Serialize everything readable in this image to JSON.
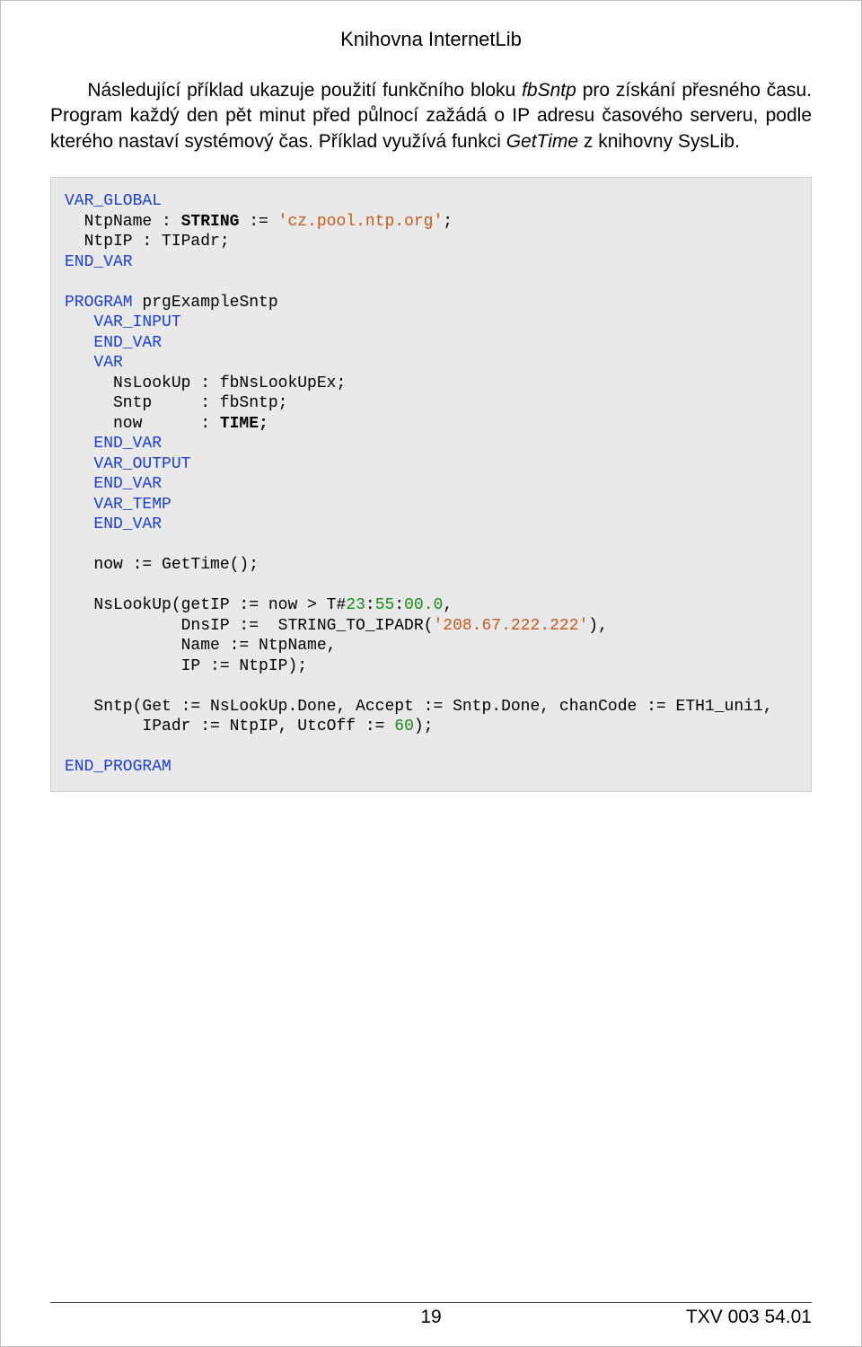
{
  "header": {
    "title": "Knihovna InternetLib"
  },
  "paragraph": {
    "p1a": "Následující příklad ukazuje použití funkčního bloku ",
    "p1b_italic": "fbSntp",
    "p1c": " pro získání přesného času. Program každý den pět minut před půlnocí zažádá o IP adresu časového serveru, podle kterého nastaví systémový čas. Příklad využívá funkci ",
    "p1d_italic": "GetTime",
    "p1e": " z knihovny SysLib."
  },
  "code": {
    "l01a": "VAR_GLOBAL",
    "l02a": "  NtpName : ",
    "l02b": "STRING",
    "l02c": " := ",
    "l02d": "'cz.pool.ntp.org'",
    "l02e": ";",
    "l03a": "  NtpIP : TIPadr;",
    "l04a": "END_VAR",
    "l06a": "PROGRAM",
    "l06b": " prgExampleSntp",
    "l07a": "   VAR_INPUT",
    "l08a": "   END_VAR",
    "l09a": "   VAR",
    "l10a": "     NsLookUp : fbNsLookUpEx;",
    "l11a": "     Sntp     : fbSntp;",
    "l12a": "     now      : ",
    "l12b": "TIME;",
    "l13a": "   END_VAR",
    "l14a": "   VAR_OUTPUT",
    "l15a": "   END_VAR",
    "l16a": "   VAR_TEMP",
    "l17a": "   END_VAR",
    "l19a": "   now := GetTime();",
    "l21a": "   NsLookUp(getIP := now > T#",
    "l21b": "23",
    "l21c": ":",
    "l21d": "55",
    "l21e": ":",
    "l21f": "00.0",
    "l21g": ",",
    "l22a": "            DnsIP :=  STRING_TO_IPADR(",
    "l22b": "'208.67.222.222'",
    "l22c": "),",
    "l23a": "            Name := NtpName,",
    "l24a": "            IP := NtpIP);",
    "l26a": "   Sntp(Get := NsLookUp.Done, Accept := Sntp.Done, chanCode := ETH1_uni1,",
    "l27a": "        IPadr := NtpIP, UtcOff := ",
    "l27b": "60",
    "l27c": ");",
    "l29a": "END_PROGRAM"
  },
  "footer": {
    "page": "19",
    "doc": "TXV 003 54.01"
  }
}
